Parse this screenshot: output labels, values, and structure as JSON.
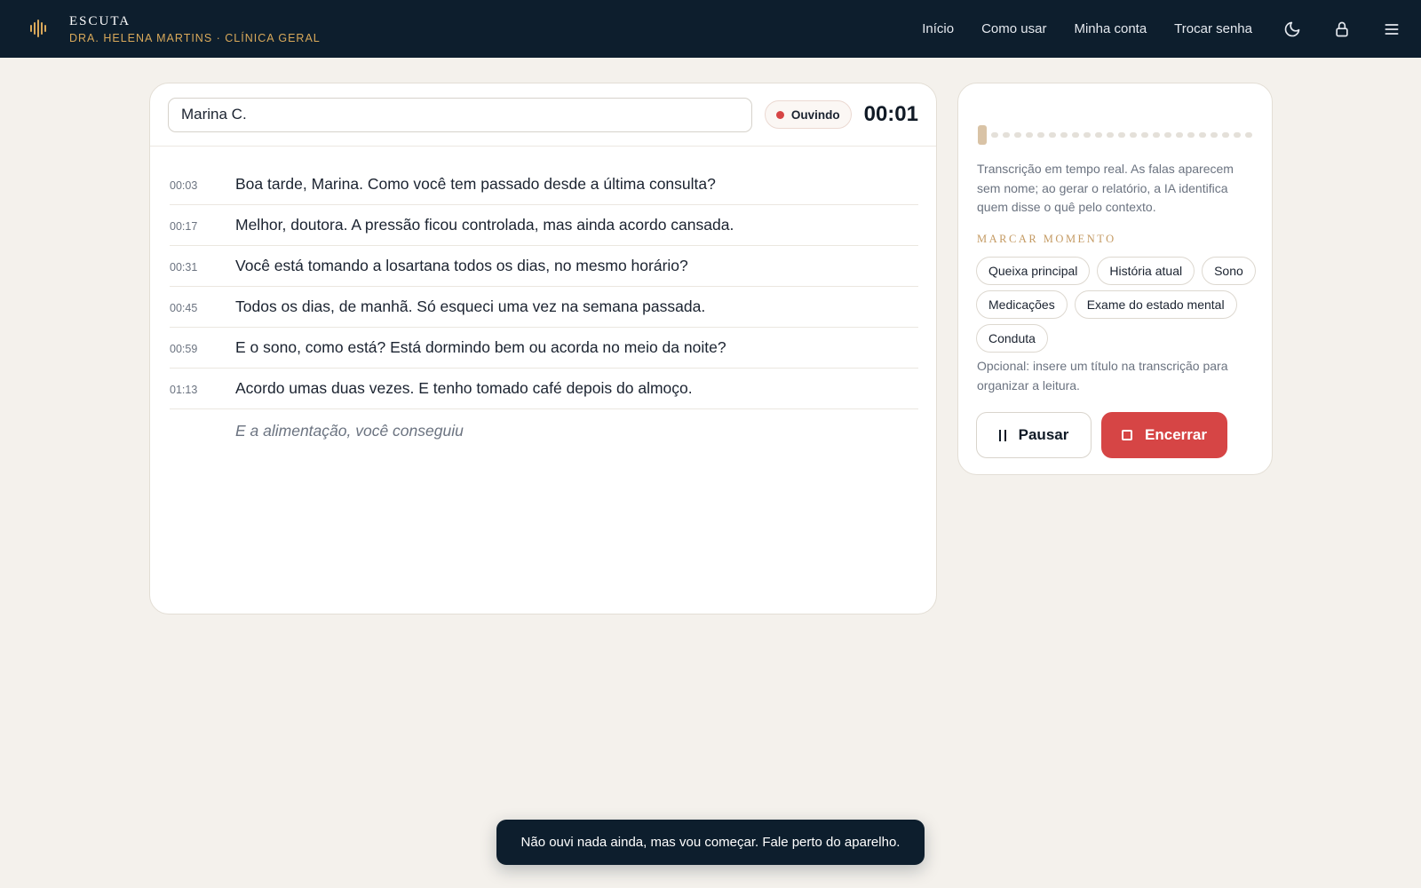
{
  "app": {
    "title": "ESCUTA",
    "subtitle": "DRA. HELENA MARTINS · CLÍNICA GERAL",
    "brand_color": "#d9a95a",
    "header_bg": "#0d1e2d"
  },
  "nav": {
    "items": [
      {
        "label": "Início"
      },
      {
        "label": "Como usar"
      },
      {
        "label": "Minha conta"
      },
      {
        "label": "Trocar senha"
      }
    ],
    "icons": [
      "moon-icon",
      "lock-icon",
      "menu-icon"
    ]
  },
  "session": {
    "patient_name": "Marina C.",
    "status_label": "Ouvindo",
    "status_color": "#d64545",
    "timer": "00:01"
  },
  "transcript": {
    "lines": [
      {
        "time": "00:03",
        "text": "Boa tarde, Marina. Como você tem passado desde a última consulta?"
      },
      {
        "time": "00:17",
        "text": "Melhor, doutora. A pressão ficou controlada, mas ainda acordo cansada."
      },
      {
        "time": "00:31",
        "text": "Você está tomando a losartana todos os dias, no mesmo horário?"
      },
      {
        "time": "00:45",
        "text": "Todos os dias, de manhã. Só esqueci uma vez na semana passada."
      },
      {
        "time": "00:59",
        "text": "E o sono, como está? Está dormindo bem ou acorda no meio da noite?"
      },
      {
        "time": "01:13",
        "text": "Acordo umas duas vezes. E tenho tomado café depois do almoço."
      }
    ],
    "partial": "E a alimentação, você conseguiu"
  },
  "side": {
    "help_text": "Transcrição em tempo real. As falas aparecem sem nome; ao gerar o relatório, a IA identifica quem disse o quê pelo contexto.",
    "mark_title": "MARCAR MOMENTO",
    "tags": [
      "Queixa principal",
      "História atual",
      "Sono",
      "Medicações",
      "Exame do estado mental",
      "Conduta"
    ],
    "optional_text": "Opcional: insere um título na transcrição para organizar a leitura.",
    "pause_label": "Pausar",
    "stop_label": "Encerrar",
    "stop_color": "#d64545"
  },
  "toast": {
    "message": "Não ouvi nada ainda, mas vou começar. Fale perto do aparelho."
  }
}
